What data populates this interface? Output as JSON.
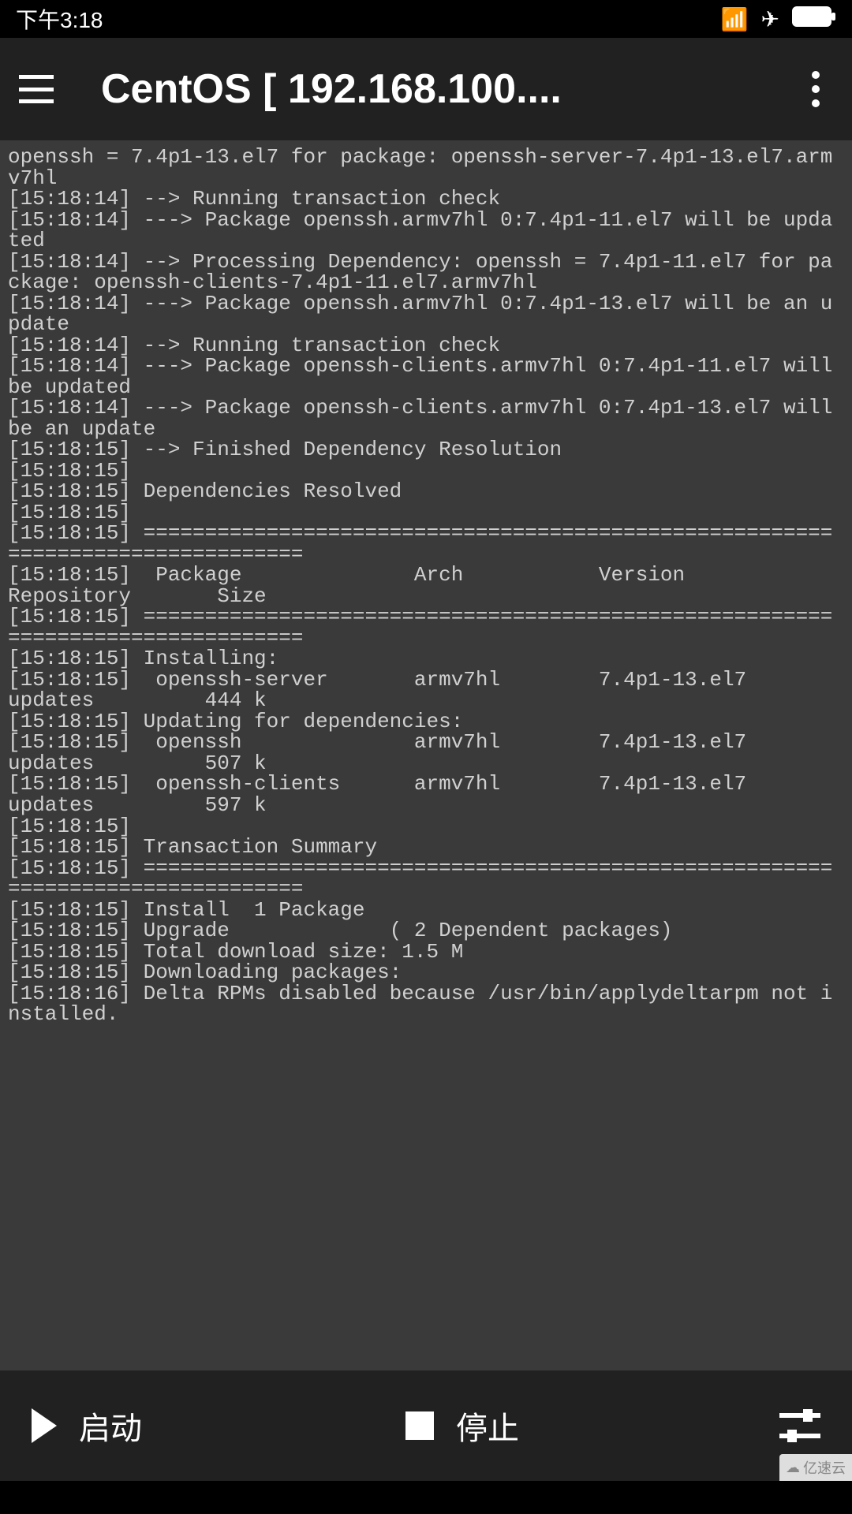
{
  "status": {
    "time": "下午3:18",
    "wifi": "📶",
    "airplane": "✈",
    "battery": "▮▮▮"
  },
  "header": {
    "title": "CentOS  [ 192.168.100...."
  },
  "terminal": {
    "content": "openssh = 7.4p1-13.el7 for package: openssh-server-7.4p1-13.el7.armv7hl\n[15:18:14] --> Running transaction check\n[15:18:14] ---> Package openssh.armv7hl 0:7.4p1-11.el7 will be updated\n[15:18:14] --> Processing Dependency: openssh = 7.4p1-11.el7 for package: openssh-clients-7.4p1-11.el7.armv7hl\n[15:18:14] ---> Package openssh.armv7hl 0:7.4p1-13.el7 will be an update\n[15:18:14] --> Running transaction check\n[15:18:14] ---> Package openssh-clients.armv7hl 0:7.4p1-11.el7 will be updated\n[15:18:14] ---> Package openssh-clients.armv7hl 0:7.4p1-13.el7 will be an update\n[15:18:15] --> Finished Dependency Resolution\n[15:18:15]\n[15:18:15] Dependencies Resolved\n[15:18:15]\n[15:18:15] ================================================================================\n[15:18:15]  Package              Arch           Version             Repository       Size\n[15:18:15] ================================================================================\n[15:18:15] Installing:\n[15:18:15]  openssh-server       armv7hl        7.4p1-13.el7        updates         444 k\n[15:18:15] Updating for dependencies:\n[15:18:15]  openssh              armv7hl        7.4p1-13.el7        updates         507 k\n[15:18:15]  openssh-clients      armv7hl        7.4p1-13.el7        updates         597 k\n[15:18:15]\n[15:18:15] Transaction Summary\n[15:18:15] ================================================================================\n[15:18:15] Install  1 Package\n[15:18:15] Upgrade             ( 2 Dependent packages)\n[15:18:15] Total download size: 1.5 M\n[15:18:15] Downloading packages:\n[15:18:16] Delta RPMs disabled because /usr/bin/applydeltarpm not installed."
  },
  "bottom": {
    "start_label": "启动",
    "stop_label": "停止"
  },
  "watermark": "亿速云"
}
